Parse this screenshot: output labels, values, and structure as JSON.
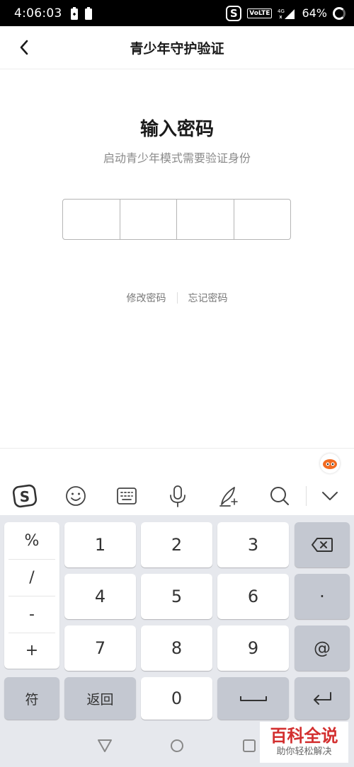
{
  "status_bar": {
    "time": "4:06:03",
    "volte": "VoLTE",
    "network": "4G",
    "battery": "64%"
  },
  "nav": {
    "title": "青少年守护验证"
  },
  "content": {
    "title": "输入密码",
    "subtitle": "启动青少年模式需要验证身份",
    "links": {
      "modify": "修改密码",
      "forgot": "忘记密码"
    }
  },
  "keyboard": {
    "symbols": [
      "%",
      "/",
      "-",
      "+"
    ],
    "digits": [
      "1",
      "2",
      "3",
      "4",
      "5",
      "6",
      "7",
      "8",
      "9",
      "0"
    ],
    "dot": "·",
    "at": "@",
    "fu": "符",
    "back": "返回"
  },
  "watermark": {
    "title": "百科全说",
    "subtitle": "助你轻松解决"
  },
  "colors": {
    "accent": "#d32f2f",
    "keyboard_bg": "#e6e8ed",
    "dark_key": "#c4c8d1"
  }
}
